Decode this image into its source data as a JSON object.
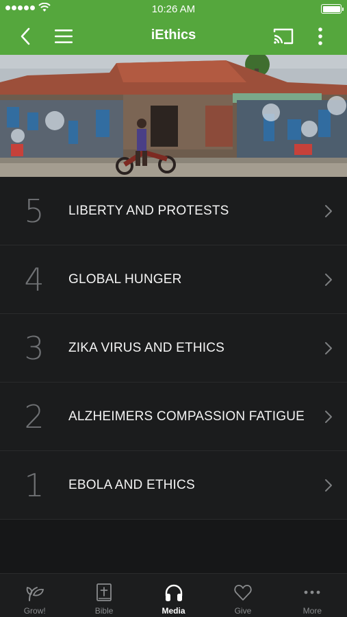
{
  "status_bar": {
    "time": "10:26 AM"
  },
  "nav": {
    "title": "iEthics",
    "back_icon": "chevron-left-icon",
    "menu_icon": "hamburger-menu-icon",
    "cast_icon": "cast-icon",
    "more_icon": "vertical-dots-icon"
  },
  "hero": {
    "image": "street-market-photo"
  },
  "episodes": [
    {
      "number": "5",
      "title": "LIBERTY AND PROTESTS"
    },
    {
      "number": "4",
      "title": "GLOBAL HUNGER"
    },
    {
      "number": "3",
      "title": "ZIKA VIRUS AND ETHICS"
    },
    {
      "number": "2",
      "title": "ALZHEIMERS COMPASSION FATIGUE"
    },
    {
      "number": "1",
      "title": "EBOLA AND ETHICS"
    }
  ],
  "tabs": [
    {
      "label": "Grow!",
      "icon": "sprout-icon",
      "active": false
    },
    {
      "label": "Bible",
      "icon": "bible-icon",
      "active": false
    },
    {
      "label": "Media",
      "icon": "headphones-icon",
      "active": true
    },
    {
      "label": "Give",
      "icon": "heart-icon",
      "active": false
    },
    {
      "label": "More",
      "icon": "ellipsis-icon",
      "active": false
    }
  ],
  "colors": {
    "header_green": "#55a73d",
    "background": "#161718",
    "row_background": "#1b1c1d"
  }
}
